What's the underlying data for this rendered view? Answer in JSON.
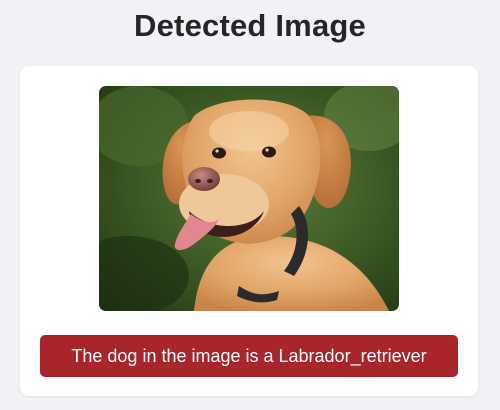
{
  "page": {
    "title": "Detected Image"
  },
  "image": {
    "subject": "dog-photo",
    "background_color": "#3a5a26"
  },
  "result": {
    "message": "The dog in the image is a Labrador_retriever",
    "background_color": "#a8252b"
  }
}
